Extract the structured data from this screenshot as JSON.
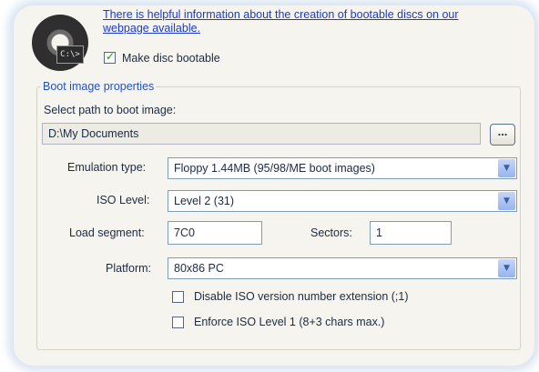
{
  "top": {
    "help_link_line1": "There is helpful information about the creation of bootable discs on our",
    "help_link_line2": "webpage available.",
    "make_bootable_label": "Make disc bootable",
    "make_bootable_checked": true,
    "disc_badge_text": "C:\\>"
  },
  "boot_image": {
    "group_title": "Boot image properties",
    "path_label": "Select path to boot image:",
    "path_value": "D:\\My Documents",
    "browse_label": "...",
    "emulation_label": "Emulation type:",
    "emulation_value": "Floppy 1.44MB (95/98/ME boot images)",
    "iso_level_label": "ISO Level:",
    "iso_level_value": "Level 2 (31)",
    "load_segment_label": "Load segment:",
    "load_segment_value": "7C0",
    "sectors_label": "Sectors:",
    "sectors_value": "1",
    "platform_label": "Platform:",
    "platform_value": "80x86 PC",
    "disable_iso_ext_label": "Disable ISO version number extension (;1)",
    "disable_iso_ext_checked": false,
    "enforce_iso_label": "Enforce ISO Level 1 (8+3 chars max.)",
    "enforce_iso_checked": false
  },
  "colors": {
    "panel_bg": "#f5f4ee",
    "link": "#1d3bc9",
    "group_title": "#2452c2",
    "input_border": "#7f9db9",
    "dropdown_arrow": "#97b4ee"
  },
  "icons": {
    "disc": "disc-icon",
    "dropdown": "chevron-down-icon"
  }
}
